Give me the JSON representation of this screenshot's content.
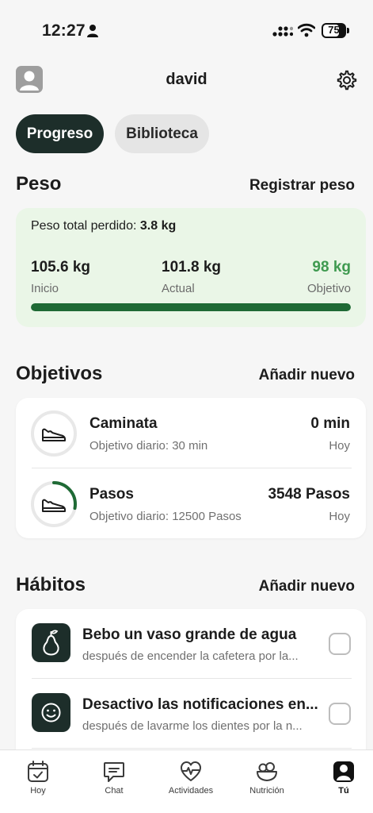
{
  "status_bar": {
    "time": "12:27",
    "battery": "75"
  },
  "header": {
    "username": "david"
  },
  "tabs": [
    {
      "label": "Progreso",
      "active": true
    },
    {
      "label": "Biblioteca",
      "active": false
    }
  ],
  "weight": {
    "title": "Peso",
    "action": "Registrar peso",
    "total_label": "Peso total perdido:",
    "total_value": "3.8 kg",
    "start_value": "105.6 kg",
    "start_label": "Inicio",
    "current_value": "101.8 kg",
    "current_label": "Actual",
    "goal_value": "98 kg",
    "goal_label": "Objetivo",
    "progress_fraction": 1.0,
    "accent_color": "#1f6a35",
    "goal_color": "#3f9a50"
  },
  "goals": {
    "title": "Objetivos",
    "action": "Añadir nuevo",
    "items": [
      {
        "name": "Caminata",
        "subtitle": "Objetivo diario: 30 min",
        "value": "0 min",
        "when": "Hoy",
        "progress": 0.0
      },
      {
        "name": "Pasos",
        "subtitle": "Objetivo diario: 12500 Pasos",
        "value": "3548 Pasos",
        "when": "Hoy",
        "progress": 0.28
      }
    ]
  },
  "habits": {
    "title": "Hábitos",
    "action": "Añadir nuevo",
    "items": [
      {
        "name": "Bebo un vaso grande de agua",
        "subtitle": "después de encender la cafetera por la...",
        "icon": "pear-icon"
      },
      {
        "name": "Desactivo las notificaciones en...",
        "subtitle": "después de lavarme los dientes por la n...",
        "icon": "smiley-icon"
      }
    ]
  },
  "tabbar": {
    "items": [
      {
        "label": "Hoy",
        "icon": "calendar-check-icon"
      },
      {
        "label": "Chat",
        "icon": "chat-icon"
      },
      {
        "label": "Actividades",
        "icon": "heart-pulse-icon"
      },
      {
        "label": "Nutrición",
        "icon": "bowl-icon"
      },
      {
        "label": "Tú",
        "icon": "profile-icon",
        "active": true
      }
    ]
  }
}
